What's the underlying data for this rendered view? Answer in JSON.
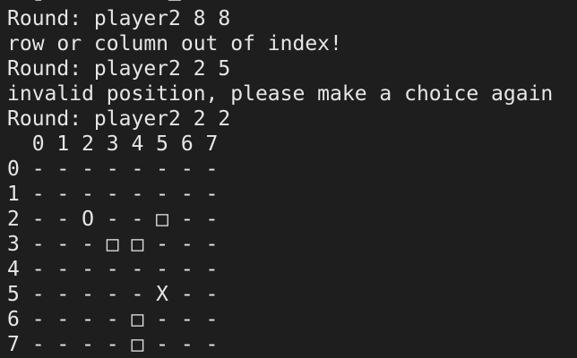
{
  "terminal": {
    "partial_top_line": "  ▯          □",
    "log": [
      "Round: player2 8 8",
      "row or column out of index!",
      "Round: player2 2 5",
      "invalid position, please make a choice again",
      "Round: player2 2 2"
    ],
    "board": {
      "column_header": "  0 1 2 3 4 5 6 7",
      "rows": [
        "0 - - - - - - - -",
        "1 - - - - - - - -",
        "2 - - O - - □ - -",
        "3 - - - □ □ - - -",
        "4 - - - - - - - -",
        "5 - - - - - X - -",
        "6 - - - - □ - - -",
        "7 - - - - □ - - -"
      ]
    }
  }
}
